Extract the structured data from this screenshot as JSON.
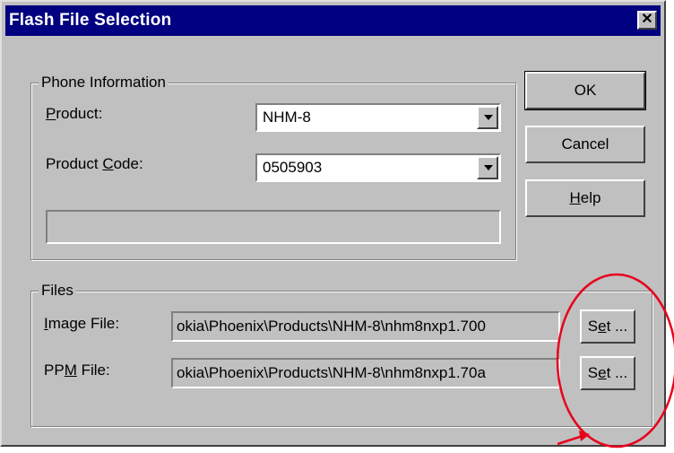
{
  "window": {
    "title": "Flash File Selection",
    "close_glyph": "✕"
  },
  "phone_info": {
    "legend": "Phone Information",
    "product_label_pre": "",
    "product_label_key": "P",
    "product_label_post": "roduct:",
    "product_value": "NHM-8",
    "code_label_pre": "Product ",
    "code_label_key": "C",
    "code_label_post": "ode:",
    "code_value": "0505903",
    "status_text": ""
  },
  "buttons": {
    "ok": "OK",
    "cancel": "Cancel",
    "help_key": "H",
    "help_rest": "elp"
  },
  "files": {
    "legend": "Files",
    "image_label_key": "I",
    "image_label_rest": "mage File:",
    "image_path": "okia\\Phoenix\\Products\\NHM-8\\nhm8nxp1.700",
    "ppm_label_pre": "PP",
    "ppm_label_key": "M",
    "ppm_label_post": " File:",
    "ppm_path": "okia\\Phoenix\\Products\\NHM-8\\nhm8nxp1.70a",
    "set_pre": "S",
    "set_key": "e",
    "set_post": "t ..."
  },
  "annotation": {
    "color": "#e8001c",
    "shape": "circle-with-arrow"
  },
  "colors": {
    "title_bar": "#000080",
    "dialog_bg": "#c0c0c0"
  }
}
